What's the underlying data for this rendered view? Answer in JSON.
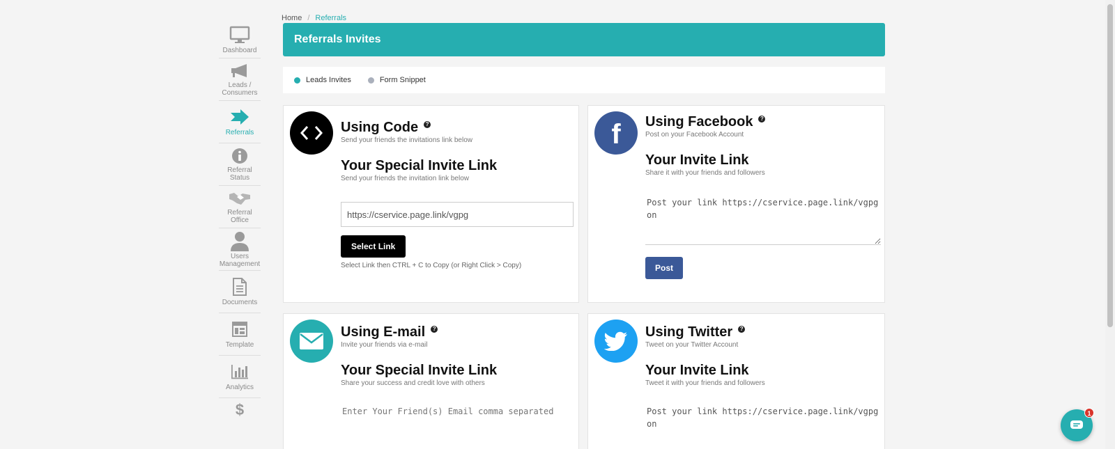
{
  "breadcrumb": {
    "home": "Home",
    "separator": "/",
    "current": "Referrals"
  },
  "header": {
    "title": "Referrals Invites"
  },
  "tabs": [
    {
      "label": "Leads Invites",
      "active": true
    },
    {
      "label": "Form Snippet",
      "active": false
    }
  ],
  "sidebar": {
    "items": [
      {
        "label": "Dashboard",
        "icon": "monitor-icon"
      },
      {
        "label": "Leads / Consumers",
        "icon": "megaphone-icon"
      },
      {
        "label": "Referrals",
        "icon": "arrow-right-icon",
        "active": true
      },
      {
        "label": "Referral Status",
        "icon": "info-icon"
      },
      {
        "label": "Referral Office",
        "icon": "handshake-icon"
      },
      {
        "label": "Users Management",
        "icon": "user-icon"
      },
      {
        "label": "Documents",
        "icon": "document-icon"
      },
      {
        "label": "Template",
        "icon": "template-icon"
      },
      {
        "label": "Analytics",
        "icon": "bar-chart-icon"
      },
      {
        "label": "",
        "icon": "dollar-icon"
      }
    ]
  },
  "cards": {
    "code": {
      "title": "Using Code",
      "subtitle": "Send your friends the invitations link below",
      "section_title": "Your Special Invite Link",
      "section_sub": "Send your friends the invitation link below",
      "link_value": "https://cservice.page.link/vgpg",
      "button": "Select Link",
      "hint": "Select Link then CTRL + C to Copy (or Right Click > Copy)"
    },
    "facebook": {
      "title": "Using Facebook",
      "subtitle": "Post on your Facebook Account",
      "section_title": "Your Invite Link",
      "section_sub": "Share it with your friends and followers",
      "post_text": "Post your link https://cservice.page.link/vgpg on",
      "button": "Post"
    },
    "email": {
      "title": "Using E-mail",
      "subtitle": "Invite your friends via e-mail",
      "section_title": "Your Special Invite Link",
      "section_sub": "Share your success and credit love with others",
      "placeholder": "Enter Your Friend(s) Email comma separated"
    },
    "twitter": {
      "title": "Using Twitter",
      "subtitle": "Tweet on your Twitter Account",
      "section_title": "Your Invite Link",
      "section_sub": "Tweet it with your friends and followers",
      "post_text": "Post your link https://cservice.page.link/vgpg on"
    }
  },
  "chat": {
    "badge": "1"
  },
  "colors": {
    "accent": "#26aeb0",
    "facebook": "#3b5998",
    "twitter": "#1da1f2",
    "email": "#26aeb0"
  }
}
